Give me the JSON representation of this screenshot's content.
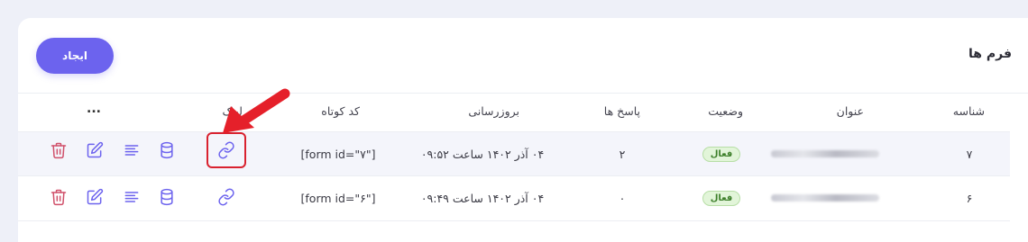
{
  "header": {
    "title": "فرم ها",
    "create_label": "ایجاد"
  },
  "table": {
    "columns": {
      "id": "شناسه",
      "title": "عنوان",
      "status": "وضعیت",
      "responses": "پاسخ ها",
      "updated": "بروزرسانی",
      "shortcode": "کد کوتاه",
      "link": "لینک",
      "more": "..."
    },
    "rows": [
      {
        "id": "۷",
        "status": "فعال",
        "responses": "۲",
        "updated": "۰۴ آذر ۱۴۰۲ ساعت ۰۹:۵۲",
        "shortcode": "[form id=\"۷\"]"
      },
      {
        "id": "۶",
        "status": "فعال",
        "responses": "۰",
        "updated": "۰۴ آذر ۱۴۰۲ ساعت ۰۹:۴۹",
        "shortcode": "[form id=\"۶\"]"
      }
    ]
  },
  "icons": {
    "link": "link-icon",
    "database": "database-icon",
    "list": "list-icon",
    "edit": "edit-icon",
    "delete": "trash-icon",
    "annotation_arrow": "arrow-icon"
  },
  "colors": {
    "primary": "#6c63ee",
    "icon": "#6c63ee",
    "delete": "#d0506a",
    "badge_bg": "#e2f5d9",
    "badge_text": "#3d7f2a",
    "highlight": "#d9222f"
  }
}
